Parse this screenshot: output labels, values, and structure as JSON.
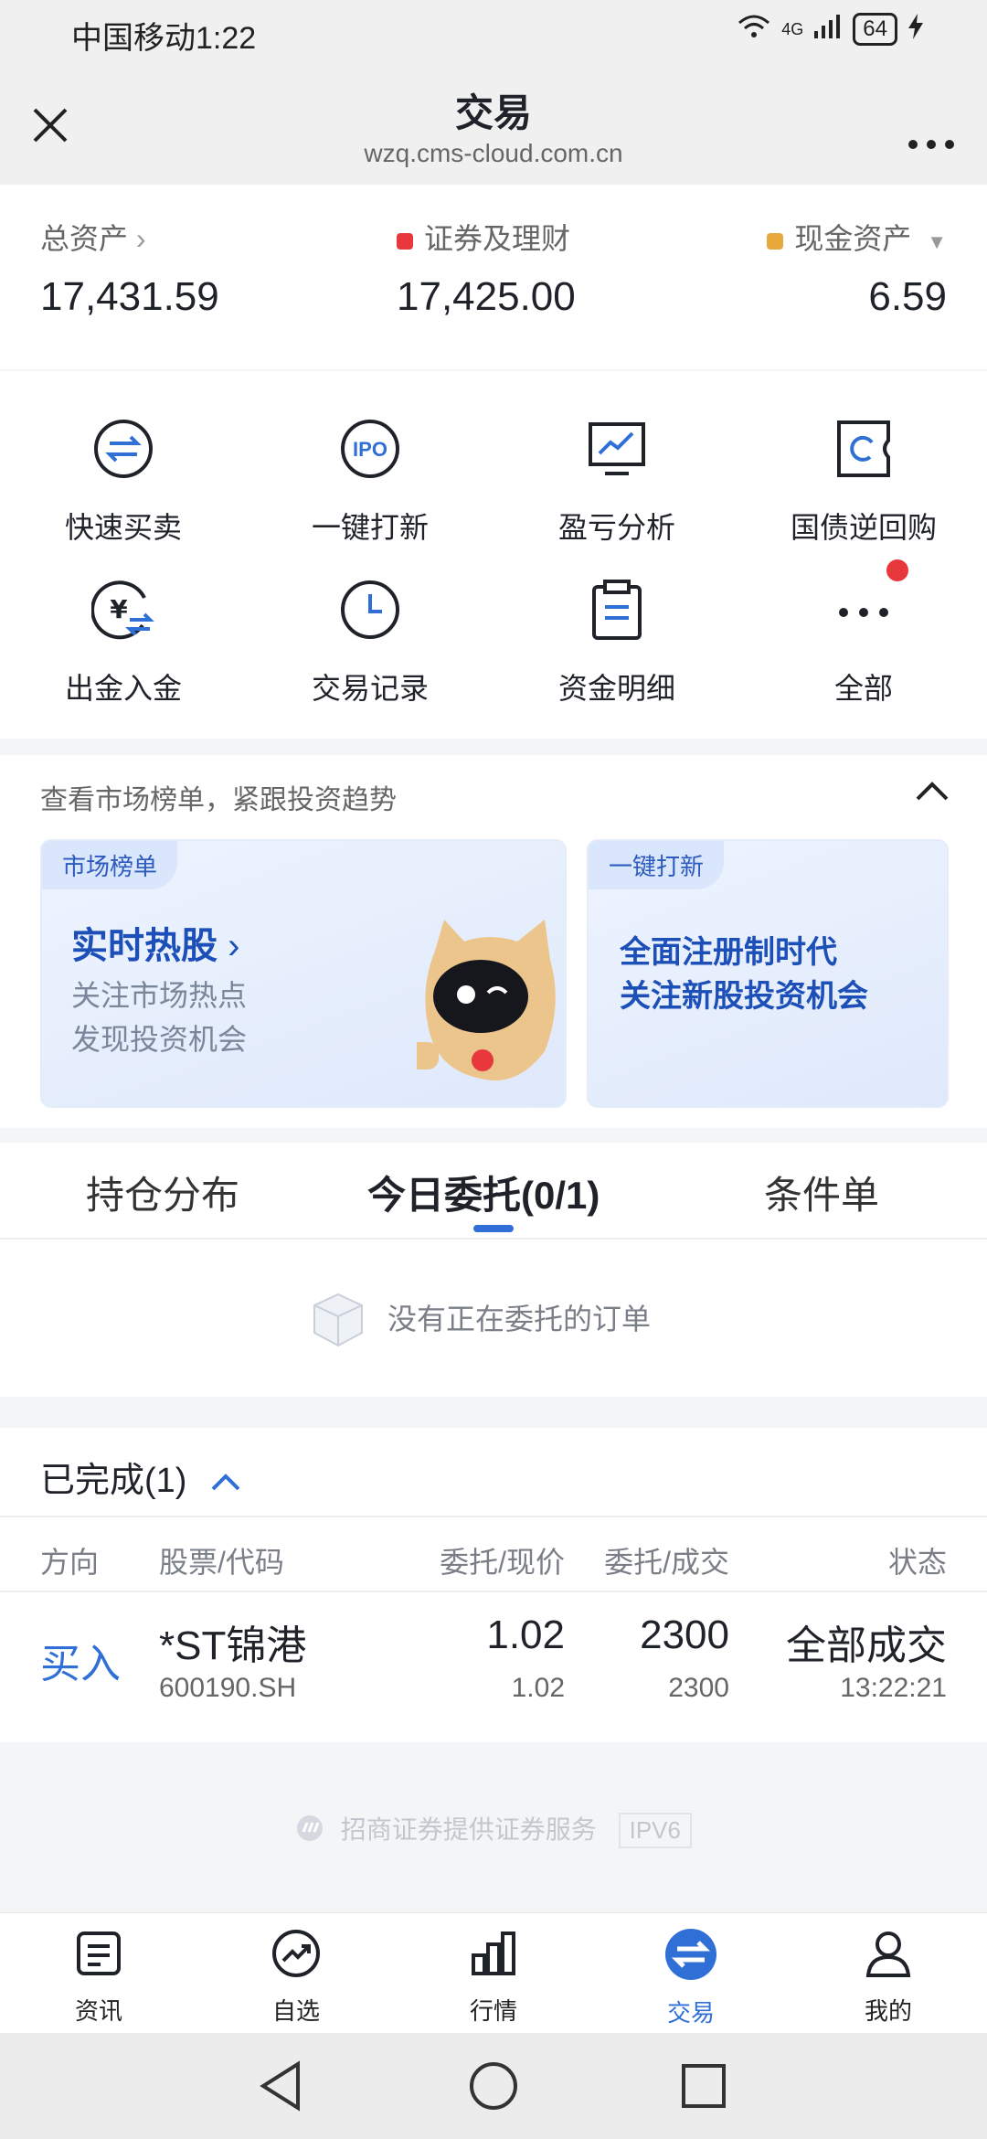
{
  "status_bar": {
    "time": "中国移动1:22",
    "network": "4G",
    "battery": "64"
  },
  "header": {
    "title": "交易",
    "url": "wzq.cms-cloud.com.cn"
  },
  "assets": {
    "total_label": "总资产",
    "total_value": "17,431.59",
    "securities_label": "证券及理财",
    "securities_value": "17,425.00",
    "securities_color": "#e8383d",
    "cash_label": "现金资产",
    "cash_value": "6.59",
    "cash_color": "#e9a93a"
  },
  "quick_actions": [
    {
      "label": "快速买卖",
      "icon": "swap-circle-icon"
    },
    {
      "label": "一键打新",
      "icon": "ipo-icon"
    },
    {
      "label": "盈亏分析",
      "icon": "monitor-chart-icon"
    },
    {
      "label": "国债逆回购",
      "icon": "ticket-icon"
    },
    {
      "label": "出金入金",
      "icon": "yuan-transfer-icon"
    },
    {
      "label": "交易记录",
      "icon": "clock-icon"
    },
    {
      "label": "资金明细",
      "icon": "clipboard-icon"
    },
    {
      "label": "全部",
      "icon": "more-dots-icon"
    }
  ],
  "market": {
    "heading": "查看市场榜单，紧跟投资趋势",
    "card1": {
      "tag": "市场榜单",
      "title": "实时热股",
      "line1": "关注市场热点",
      "line2": "发现投资机会"
    },
    "card2": {
      "tag": "一键打新",
      "line1": "全面注册制时代",
      "line2": "关注新股投资机会"
    }
  },
  "order_tabs": [
    "持仓分布",
    "今日委托(0/1)",
    "条件单"
  ],
  "empty_text": "没有正在委托的订单",
  "completed": {
    "title": "已完成(1)",
    "headers": [
      "方向",
      "股票/代码",
      "委托/现价",
      "委托/成交",
      "状态"
    ],
    "rows": [
      {
        "direction": "买入",
        "name": "*ST锦港",
        "code": "600190.SH",
        "order_price": "1.02",
        "current_price": "1.02",
        "order_qty": "2300",
        "filled_qty": "2300",
        "status": "全部成交",
        "time": "13:22:21"
      }
    ]
  },
  "footer": {
    "text": "招商证券提供证券服务",
    "badge": "IPV6"
  },
  "nav": [
    {
      "label": "资讯",
      "icon": "news-icon"
    },
    {
      "label": "自选",
      "icon": "trend-icon"
    },
    {
      "label": "行情",
      "icon": "bar-chart-icon"
    },
    {
      "label": "交易",
      "icon": "trade-icon"
    },
    {
      "label": "我的",
      "icon": "user-icon"
    }
  ],
  "colors": {
    "accent": "#2f6fd6",
    "buy": "#2f6fd6"
  }
}
